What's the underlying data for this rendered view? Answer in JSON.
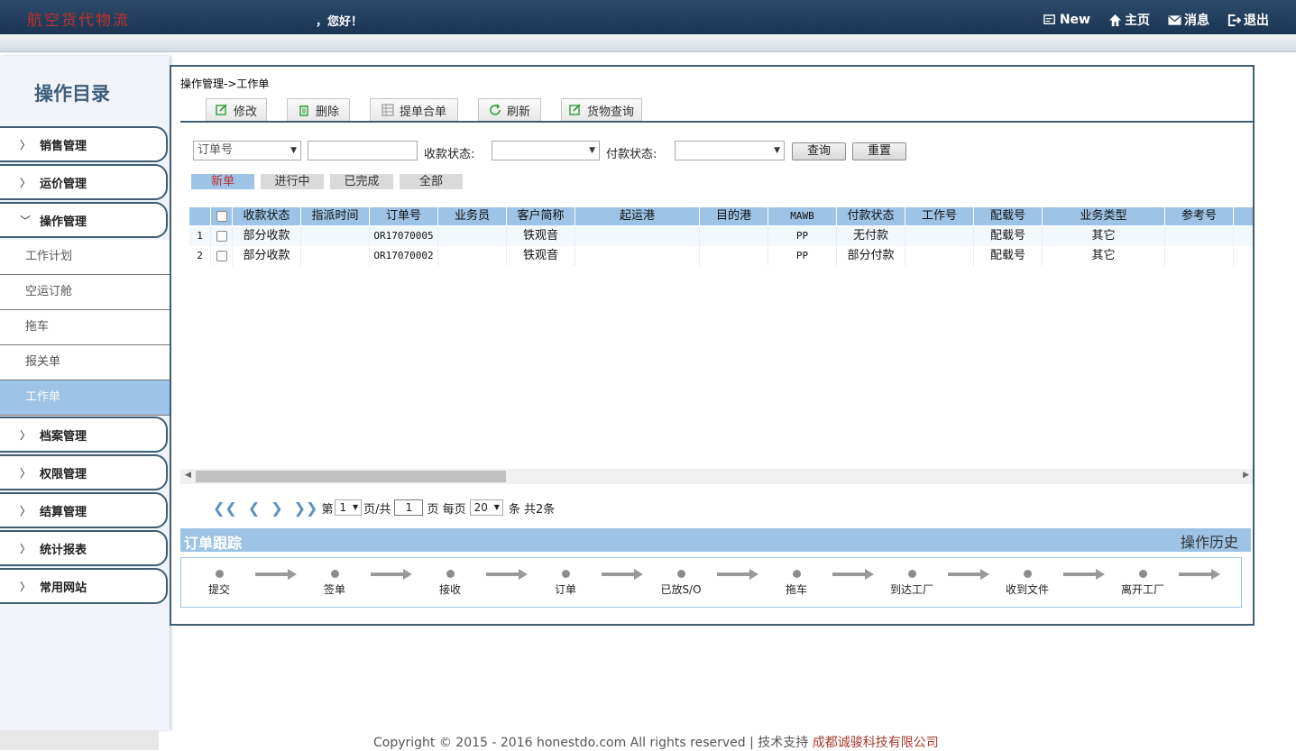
{
  "header": {
    "logo": "航空货代物流",
    "greeting": "，您好！",
    "nav": [
      {
        "label": "New",
        "icon": "new-window-icon"
      },
      {
        "label": "主页",
        "icon": "home-icon"
      },
      {
        "label": "消息",
        "icon": "mail-icon"
      },
      {
        "label": "退出",
        "icon": "logout-icon"
      }
    ]
  },
  "sidebar": {
    "title": "操作目录",
    "menus": [
      {
        "label": "销售管理"
      },
      {
        "label": "运价管理"
      },
      {
        "label": "操作管理",
        "expanded": true
      }
    ],
    "sub_items": [
      "工作计划",
      "空运订舱",
      "拖车",
      "报关单",
      "工作单"
    ],
    "active_sub": "工作单",
    "menus_after": [
      {
        "label": "档案管理"
      },
      {
        "label": "权限管理"
      },
      {
        "label": "结算管理"
      },
      {
        "label": "统计报表"
      },
      {
        "label": "常用网站"
      }
    ]
  },
  "main": {
    "breadcrumb": "操作管理->工作单",
    "toolbar": [
      {
        "label": "修改",
        "icon": "edit-icon"
      },
      {
        "label": "删除",
        "icon": "trash-icon"
      },
      {
        "label": "提单合单",
        "icon": "merge-icon"
      },
      {
        "label": "刷新",
        "icon": "refresh-icon"
      },
      {
        "label": "货物查询",
        "icon": "search-cargo-icon"
      }
    ],
    "filter": {
      "field_select": "订单号",
      "keyword": "",
      "receipt_label": "收款状态:",
      "receipt_value": "",
      "payment_label": "付款状态:",
      "payment_value": "",
      "query_btn": "查询",
      "reset_btn": "重置"
    },
    "status_tabs": [
      {
        "label": "新单",
        "active": true
      },
      {
        "label": "进行中"
      },
      {
        "label": "已完成"
      },
      {
        "label": "全部"
      }
    ],
    "table": {
      "columns": [
        "收款状态",
        "指派时间",
        "订单号",
        "业务员",
        "客户简称",
        "起运港",
        "目的港",
        "MAWB",
        "付款状态",
        "工作号",
        "配载号",
        "业务类型",
        "参考号"
      ],
      "rows": [
        {
          "n": "1",
          "cells": [
            "部分收款",
            "",
            "OR17070005",
            "",
            "铁观音",
            "",
            "",
            "PP",
            "无付款",
            "",
            "配载号",
            "其它",
            ""
          ]
        },
        {
          "n": "2",
          "cells": [
            "部分收款",
            "",
            "OR17070002",
            "",
            "铁观音",
            "",
            "",
            "PP",
            "部分付款",
            "",
            "配载号",
            "其它",
            ""
          ]
        }
      ]
    },
    "pager": {
      "prefix": "第",
      "page": "1",
      "of_label": "页/共",
      "total_pages": "1",
      "per_label": "页 每页",
      "page_size": "20",
      "count_label": "条 共2条"
    },
    "tracking": {
      "title": "订单跟踪",
      "history": "操作历史",
      "steps": [
        "提交",
        "签单",
        "接收",
        "订单",
        "已放S/O",
        "拖车",
        "到达工厂",
        "收到文件",
        "离开工厂"
      ]
    }
  },
  "footer": {
    "text": "Copyright © 2015 - 2016 honestdo.com All rights reserved | 技术支持",
    "company": "成都诚骏科技有限公司"
  },
  "colors": {
    "header_bg": "#1b3552",
    "accent_blue": "#9dc3e6",
    "border_dark": "#3f5d73",
    "logo_red": "#c0302a"
  }
}
